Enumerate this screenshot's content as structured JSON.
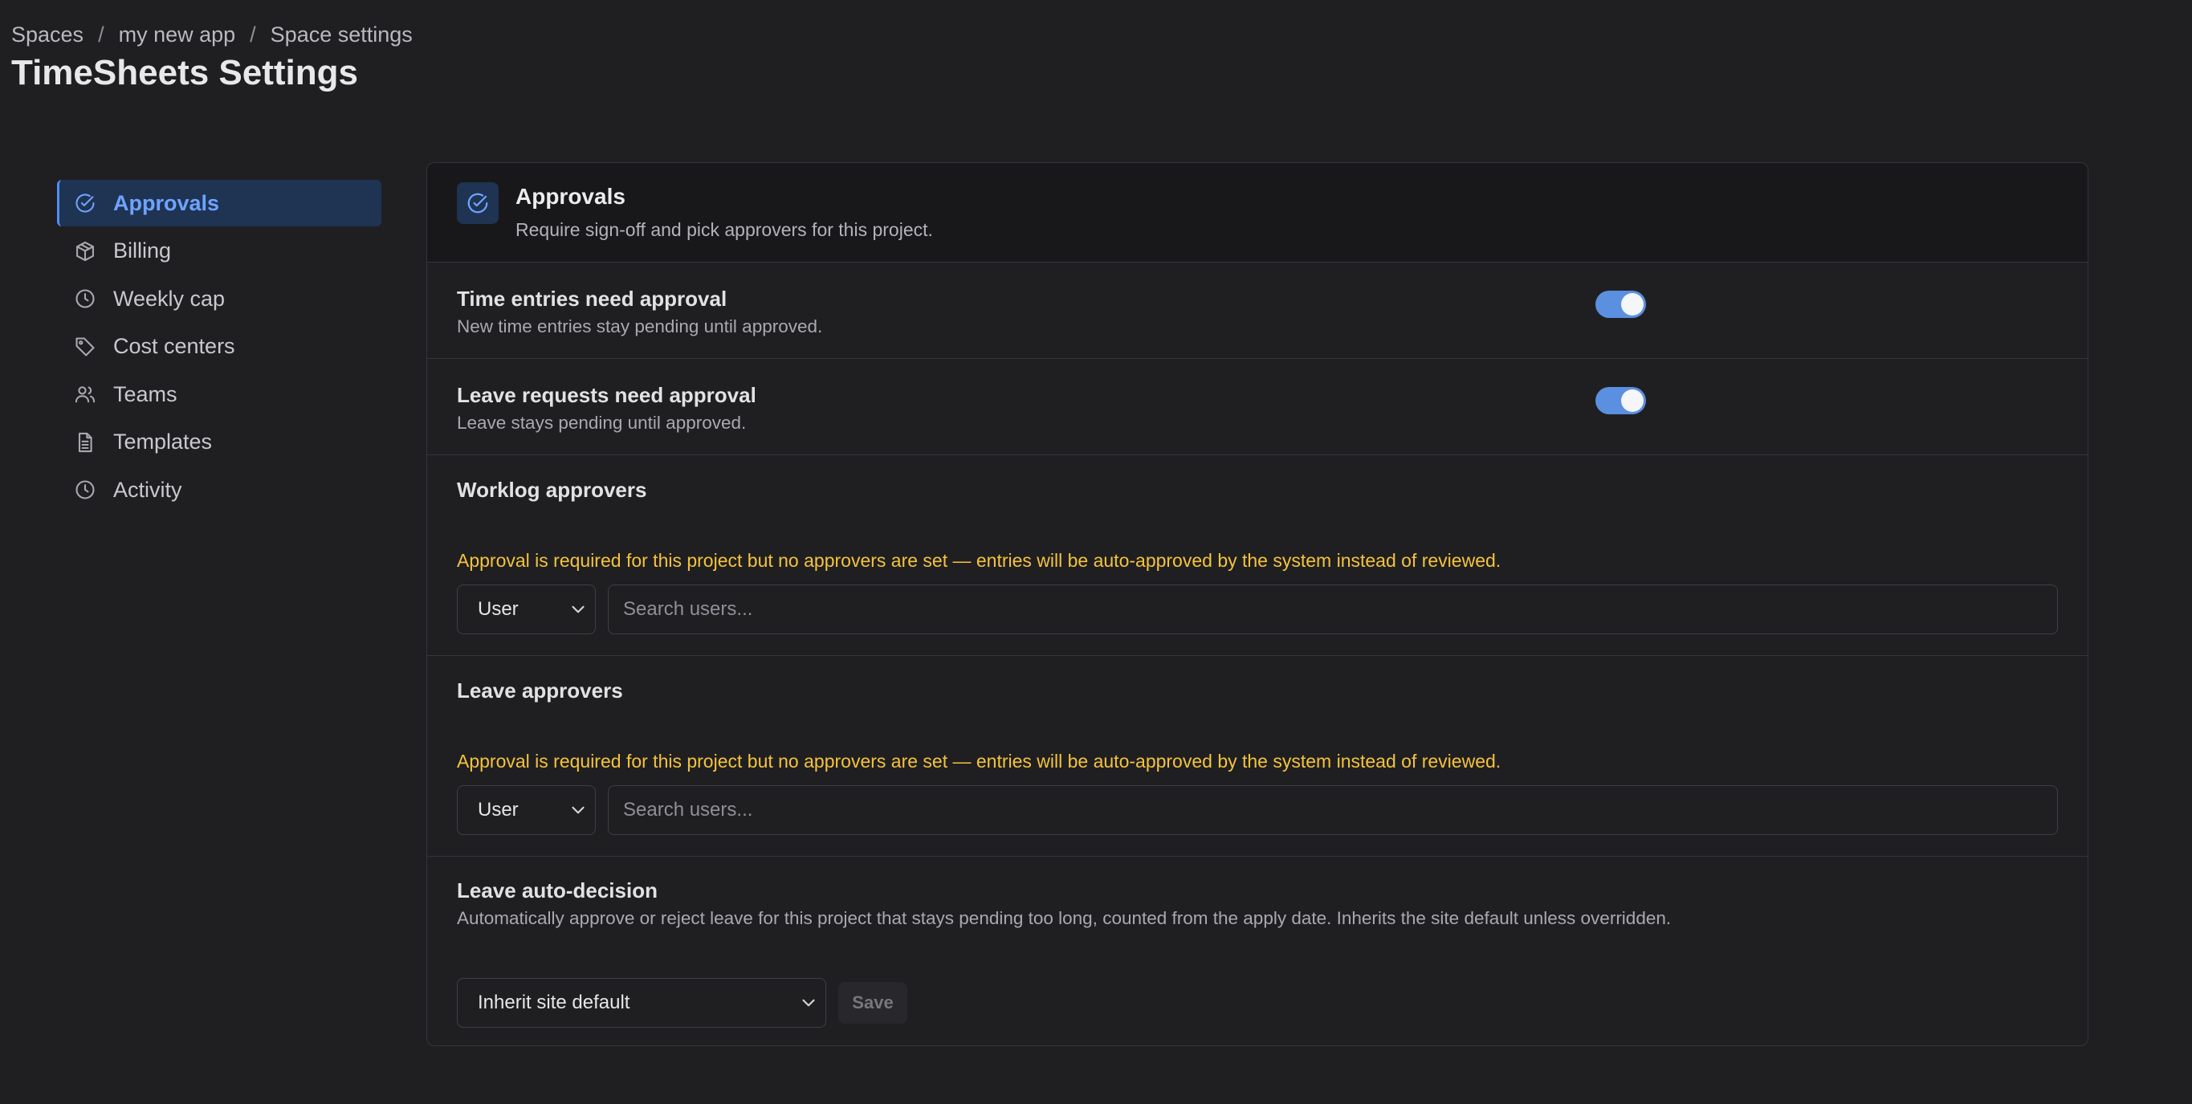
{
  "breadcrumb": {
    "items": [
      "Spaces",
      "my new app",
      "Space settings"
    ],
    "separator": "/"
  },
  "page": {
    "title": "TimeSheets Settings"
  },
  "sidebar": {
    "items": [
      {
        "label": "Approvals",
        "icon": "check-circle-icon",
        "active": true
      },
      {
        "label": "Billing",
        "icon": "box-icon"
      },
      {
        "label": "Weekly cap",
        "icon": "clock-icon"
      },
      {
        "label": "Cost centers",
        "icon": "tag-icon"
      },
      {
        "label": "Teams",
        "icon": "users-icon"
      },
      {
        "label": "Templates",
        "icon": "document-icon"
      },
      {
        "label": "Activity",
        "icon": "clock-icon"
      }
    ]
  },
  "panel": {
    "title": "Approvals",
    "subtitle": "Require sign-off and pick approvers for this project.",
    "time_entries": {
      "title": "Time entries need approval",
      "subtitle": "New time entries stay pending until approved.",
      "enabled": true
    },
    "leave_requests": {
      "title": "Leave requests need approval",
      "subtitle": "Leave stays pending until approved.",
      "enabled": true
    },
    "worklog_approvers": {
      "title": "Worklog approvers",
      "warning": "Approval is required for this project but no approvers are set — entries will be auto-approved by the system instead of reviewed.",
      "type_value": "User",
      "search_placeholder": "Search users..."
    },
    "leave_approvers": {
      "title": "Leave approvers",
      "warning": "Approval is required for this project but no approvers are set — entries will be auto-approved by the system instead of reviewed.",
      "type_value": "User",
      "search_placeholder": "Search users..."
    },
    "auto_decision": {
      "title": "Leave auto-decision",
      "subtitle": "Automatically approve or reject leave for this project that stays pending too long, counted from the apply date. Inherits the site default unless overridden.",
      "select_value": "Inherit site default",
      "save_label": "Save"
    }
  },
  "colors": {
    "background": "#1f1f22",
    "accent": "#6ea3ff",
    "toggle_on": "#5b8fe0",
    "warning": "#f5c33b"
  }
}
